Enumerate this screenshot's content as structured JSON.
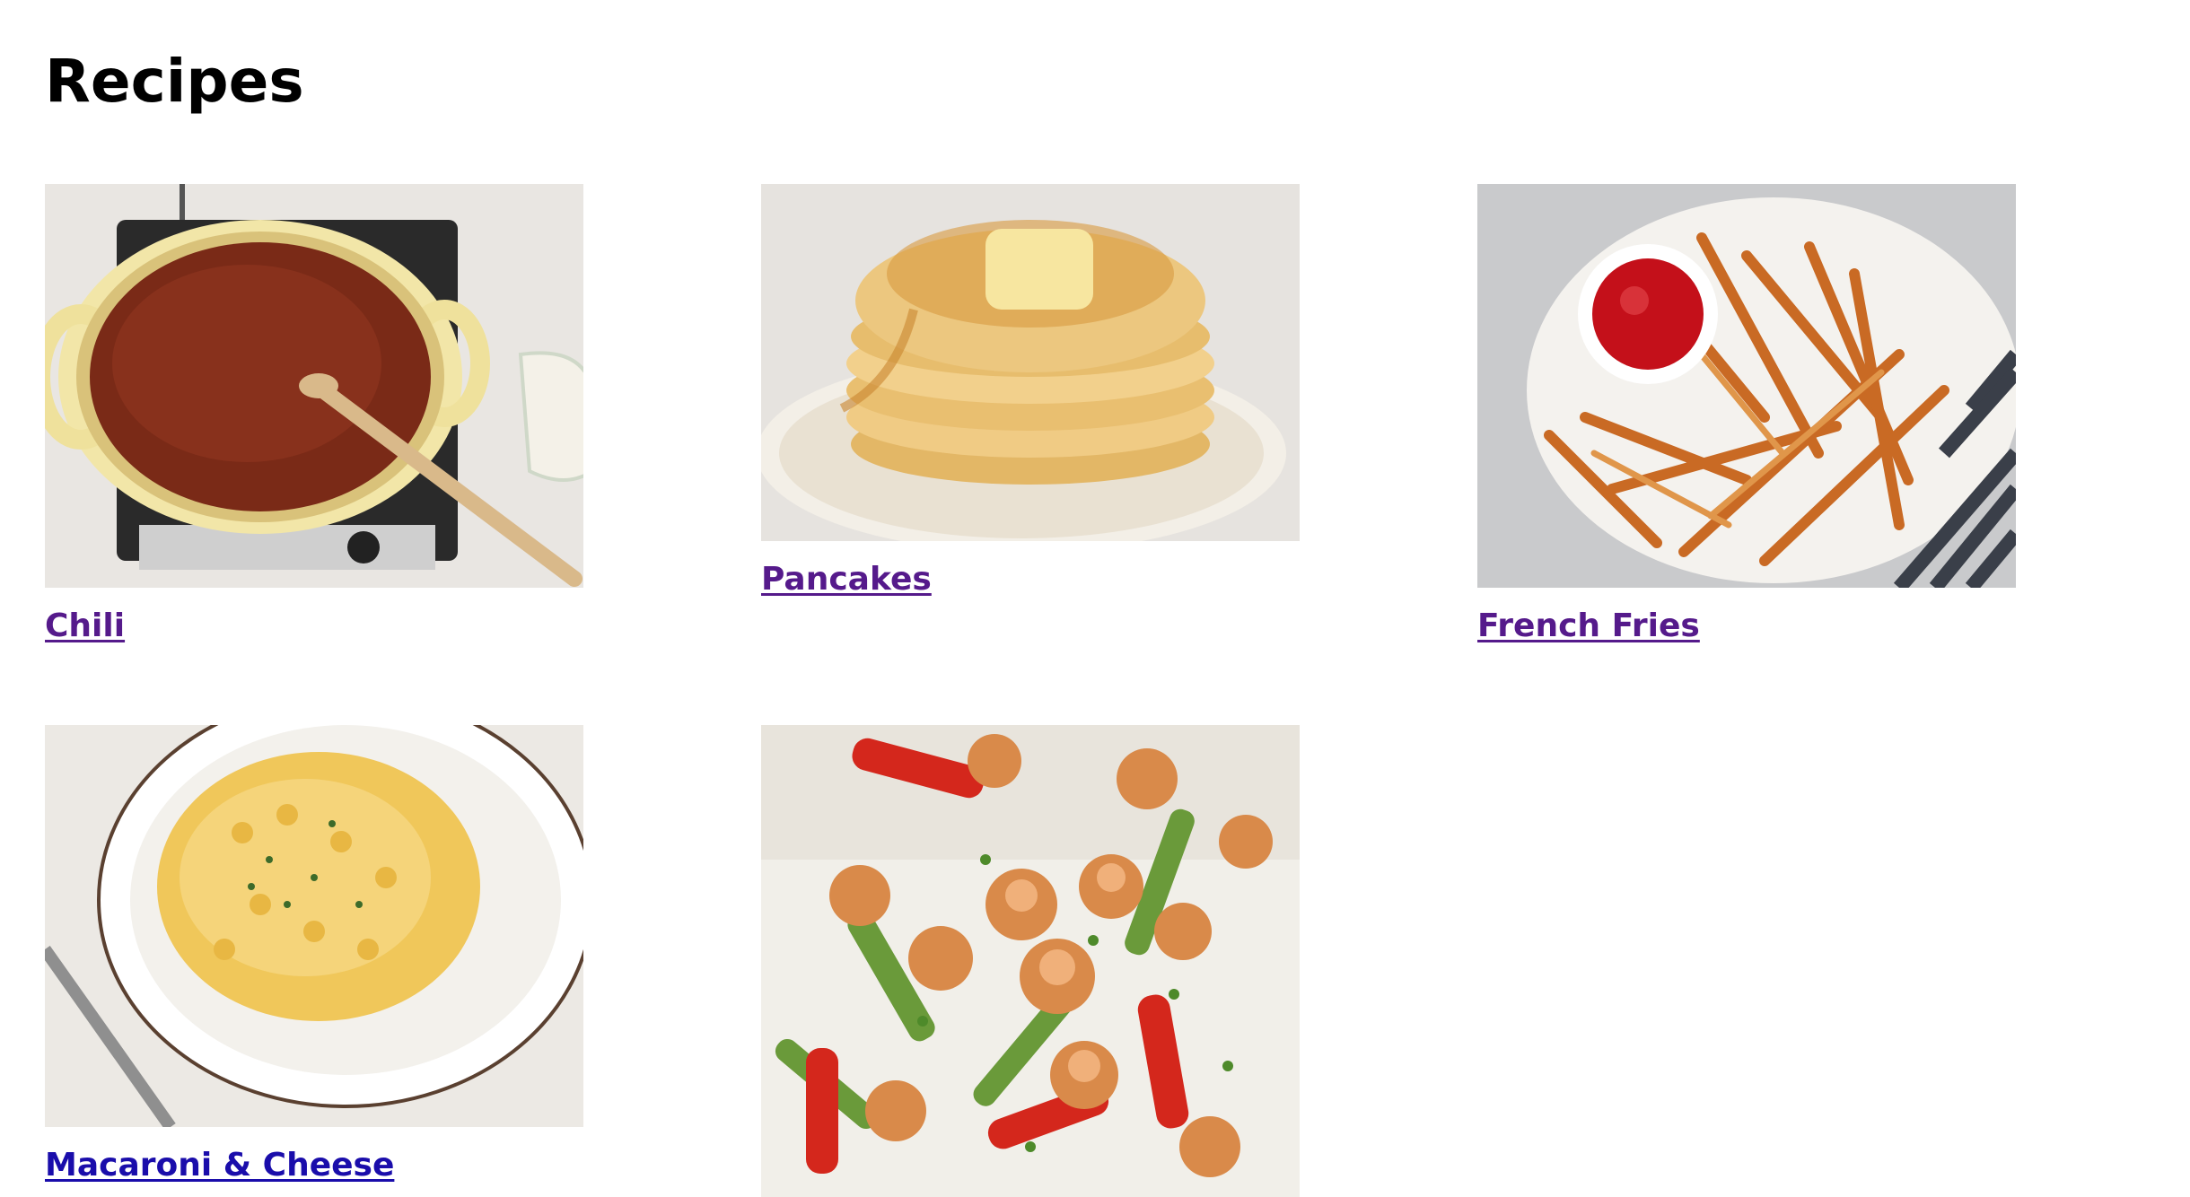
{
  "page": {
    "title": "Recipes"
  },
  "recipes": [
    {
      "name": "Chili",
      "image": "chili-photo",
      "visited": true
    },
    {
      "name": "Pancakes",
      "image": "pancakes-photo",
      "visited": true
    },
    {
      "name": "French Fries",
      "image": "french-fries-photo",
      "visited": true
    },
    {
      "name": "Macaroni & Cheese",
      "image": "macaroni-cheese-photo",
      "visited": false
    },
    {
      "name": "",
      "image": "shrimp-stir-fry-photo",
      "visited": false
    }
  ],
  "colors": {
    "link_visited": "#551a8b",
    "link_unvisited": "#1a0dab",
    "title": "#000000",
    "background": "#ffffff"
  }
}
